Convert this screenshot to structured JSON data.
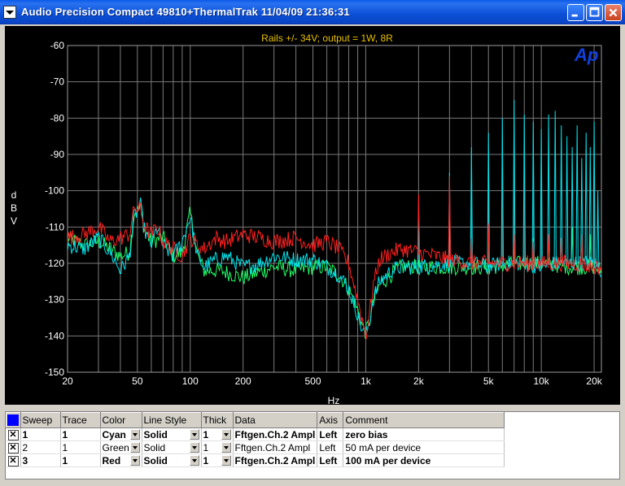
{
  "window": {
    "title": "Audio Precision  Compact 49810+ThermalTrak  11/04/09 21:36:31"
  },
  "chart_data": {
    "type": "line",
    "title": "Rails +/- 34V; output = 1W, 8R",
    "logo": "Ap",
    "xlabel": "Hz",
    "ylabel": "dBV",
    "x_scale": "log",
    "xlim": [
      20,
      22000
    ],
    "ylim": [
      -150,
      -60
    ],
    "x_ticks": [
      20,
      50,
      100,
      200,
      500,
      1000,
      2000,
      5000,
      10000,
      20000
    ],
    "x_tick_labels": [
      "20",
      "50",
      "100",
      "200",
      "500",
      "1k",
      "2k",
      "5k",
      "10k",
      "20k"
    ],
    "y_ticks": [
      -60,
      -70,
      -80,
      -90,
      -100,
      -110,
      -120,
      -130,
      -140,
      -150
    ],
    "y_tick_labels": [
      "-60",
      "-70",
      "-80",
      "-90",
      "-100",
      "-110",
      "-120",
      "-130",
      "-140",
      "-150"
    ],
    "grid": true,
    "series": [
      {
        "name": "zero bias",
        "color": "#00e5ee",
        "x": [
          20,
          25,
          30,
          35,
          40,
          45,
          48,
          52,
          55,
          60,
          65,
          70,
          80,
          90,
          100,
          110,
          120,
          140,
          160,
          200,
          250,
          300,
          400,
          500,
          600,
          700,
          800,
          900,
          950,
          1000,
          1050,
          1100,
          1200,
          1400,
          1600,
          2000,
          3000,
          4000,
          5000,
          6000,
          7000,
          8000,
          10000,
          12000,
          15000,
          20000,
          22000
        ],
        "y": [
          -115,
          -116,
          -113,
          -117,
          -122,
          -118,
          -107,
          -104,
          -111,
          -115,
          -110,
          -115,
          -118,
          -114,
          -107,
          -118,
          -121,
          -119,
          -118,
          -121,
          -120,
          -118,
          -119,
          -119,
          -121,
          -123,
          -127,
          -134,
          -138,
          -140,
          -136,
          -130,
          -125,
          -122,
          -121,
          -121,
          -120,
          -120,
          -121,
          -120,
          -120,
          -120,
          -121,
          -120,
          -120,
          -120,
          -122
        ],
        "peaks": [
          [
            2000,
            -104
          ],
          [
            3000,
            -95
          ],
          [
            4000,
            -88
          ],
          [
            5000,
            -84
          ],
          [
            6000,
            -80
          ],
          [
            7000,
            -75
          ],
          [
            8000,
            -79
          ],
          [
            9000,
            -81
          ],
          [
            10000,
            -83
          ],
          [
            11000,
            -79
          ],
          [
            12000,
            -78
          ],
          [
            13000,
            -82
          ],
          [
            14000,
            -85
          ],
          [
            15000,
            -88
          ],
          [
            16000,
            -82
          ],
          [
            17000,
            -91
          ],
          [
            18000,
            -84
          ],
          [
            19000,
            -88
          ],
          [
            20000,
            -81
          ],
          [
            21000,
            -100
          ]
        ]
      },
      {
        "name": "50 mA per device",
        "color": "#20ff6a",
        "x": [
          20,
          25,
          30,
          35,
          40,
          45,
          48,
          52,
          55,
          60,
          70,
          80,
          90,
          100,
          110,
          120,
          150,
          200,
          300,
          400,
          500,
          600,
          700,
          800,
          900,
          950,
          1000,
          1050,
          1100,
          1200,
          1400,
          1600,
          2000,
          3000,
          5000,
          8000,
          10000,
          15000,
          20000,
          22000
        ],
        "y": [
          -113,
          -115,
          -114,
          -116,
          -118,
          -117,
          -106,
          -105,
          -111,
          -114,
          -113,
          -118,
          -117,
          -106,
          -118,
          -122,
          -122,
          -124,
          -121,
          -122,
          -121,
          -121,
          -123,
          -127,
          -133,
          -137,
          -139,
          -136,
          -131,
          -126,
          -123,
          -121,
          -121,
          -121,
          -121,
          -120,
          -120,
          -121,
          -121,
          -122
        ],
        "peaks": [
          [
            3000,
            -108
          ],
          [
            5000,
            -109
          ],
          [
            7000,
            -114
          ],
          [
            9000,
            -113
          ],
          [
            11000,
            -113
          ],
          [
            13000,
            -113
          ],
          [
            15000,
            -110
          ],
          [
            17000,
            -113
          ],
          [
            19000,
            -112
          ]
        ]
      },
      {
        "name": "100 mA per device",
        "color": "#ff2020",
        "x": [
          20,
          25,
          30,
          35,
          40,
          45,
          48,
          52,
          55,
          60,
          65,
          70,
          80,
          90,
          100,
          110,
          120,
          140,
          160,
          200,
          250,
          300,
          400,
          500,
          600,
          700,
          800,
          900,
          950,
          1000,
          1050,
          1100,
          1200,
          1400,
          1600,
          2000,
          2500,
          3000,
          4000,
          5000,
          7000,
          10000,
          15000,
          20000,
          22000
        ],
        "y": [
          -113,
          -112,
          -110,
          -114,
          -113,
          -112,
          -105,
          -105,
          -110,
          -112,
          -110,
          -114,
          -116,
          -118,
          -113,
          -115,
          -116,
          -113,
          -114,
          -112,
          -113,
          -114,
          -113,
          -115,
          -114,
          -116,
          -120,
          -130,
          -135,
          -140,
          -134,
          -126,
          -119,
          -117,
          -116,
          -117,
          -118,
          -119,
          -120,
          -120,
          -120,
          -120,
          -120,
          -121,
          -121
        ],
        "peaks": [
          [
            2000,
            -101
          ],
          [
            3000,
            -96
          ],
          [
            4000,
            -113
          ],
          [
            5000,
            -109
          ],
          [
            7000,
            -112
          ],
          [
            9000,
            -114
          ],
          [
            11000,
            -112
          ],
          [
            13000,
            -113
          ],
          [
            17000,
            -112
          ]
        ]
      }
    ]
  },
  "table": {
    "columns": [
      "Sweep",
      "Trace",
      "Color",
      "Line Style",
      "Thick",
      "Data",
      "Axis",
      "Comment"
    ],
    "rows": [
      {
        "checked": "✕",
        "sweep": "1",
        "trace": "1",
        "color": "Cyan",
        "style": "Solid",
        "thick": "1",
        "data": "Fftgen.Ch.2 Ampl",
        "axis": "Left",
        "comment": "zero bias",
        "bold": true
      },
      {
        "checked": "✕",
        "sweep": "2",
        "trace": "1",
        "color": "Green",
        "style": "Solid",
        "thick": "1",
        "data": "Fftgen.Ch.2 Ampl",
        "axis": "Left",
        "comment": "50 mA per device",
        "bold": false
      },
      {
        "checked": "✕",
        "sweep": "3",
        "trace": "1",
        "color": "Red",
        "style": "Solid",
        "thick": "1",
        "data": "Fftgen.Ch.2 Ampl",
        "axis": "Left",
        "comment": "100 mA per device",
        "bold": true
      }
    ]
  }
}
